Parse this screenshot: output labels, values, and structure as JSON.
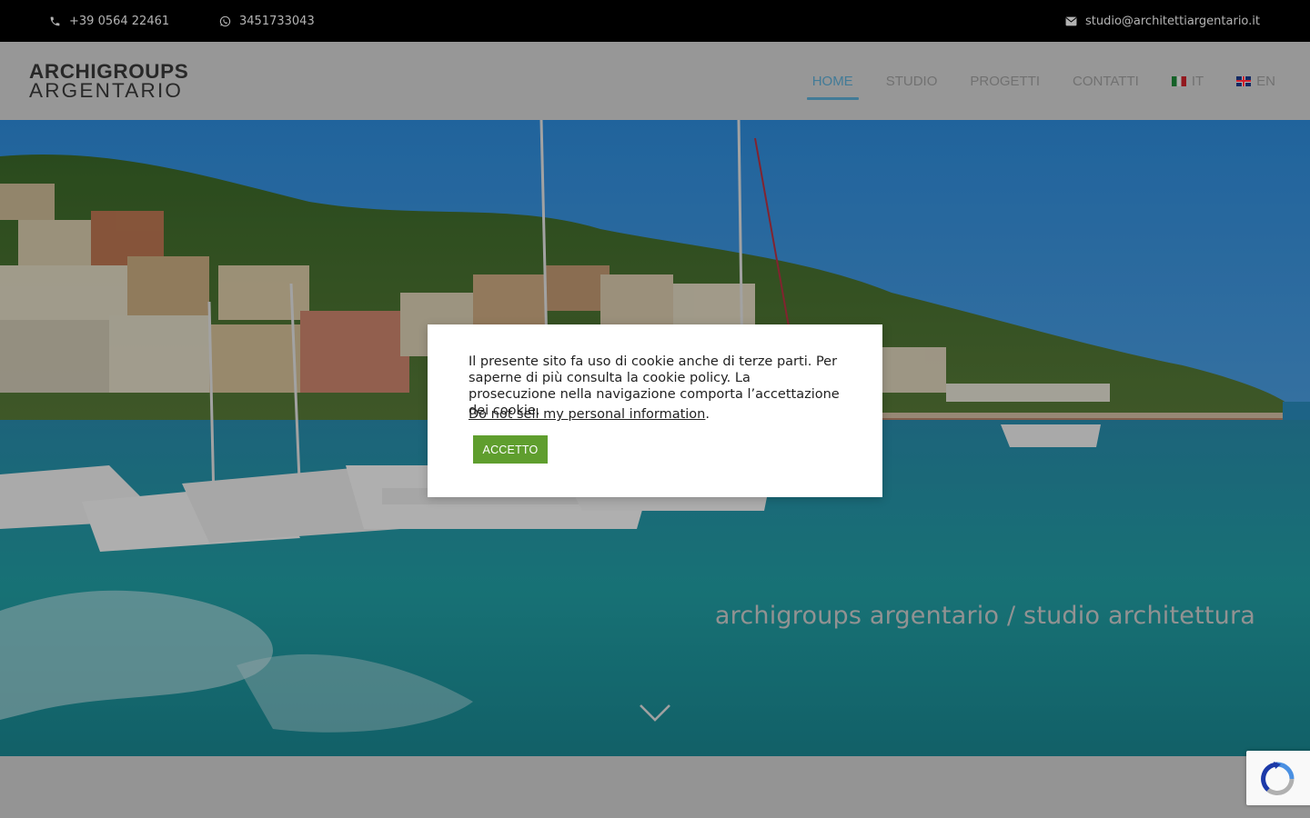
{
  "topbar": {
    "phone": "+39 0564 22461",
    "whatsapp": "3451733043",
    "email": "studio@architettiargentario.it"
  },
  "logo": {
    "line1": "ARCHIGROUPS",
    "line2": "ARGENTARIO"
  },
  "nav": {
    "items": [
      {
        "label": "HOME",
        "active": true
      },
      {
        "label": "STUDIO"
      },
      {
        "label": "PROGETTI"
      },
      {
        "label": "CONTATTI"
      },
      {
        "label": "IT",
        "flag": "italy-flag-icon"
      },
      {
        "label": "EN",
        "flag": "uk-flag-icon"
      }
    ],
    "active_color": "#5fb0d8"
  },
  "hero": {
    "tagline": "archigroups argentario / studio architettura",
    "scroll_icon": "chevron-down-icon"
  },
  "cookie": {
    "text": "Il presente sito fa uso di cookie anche di terze parti. Per saperne di più consulta la cookie policy. La prosecuzione nella navigazione comporta l’accettazione dei cookie.",
    "do_not_sell": "Do not sell my personal information",
    "do_not_sell_suffix": ".",
    "accept_label": "ACCETTO",
    "accept_color": "#5f9e2e"
  },
  "recaptcha": {
    "icon": "recaptcha-icon"
  }
}
